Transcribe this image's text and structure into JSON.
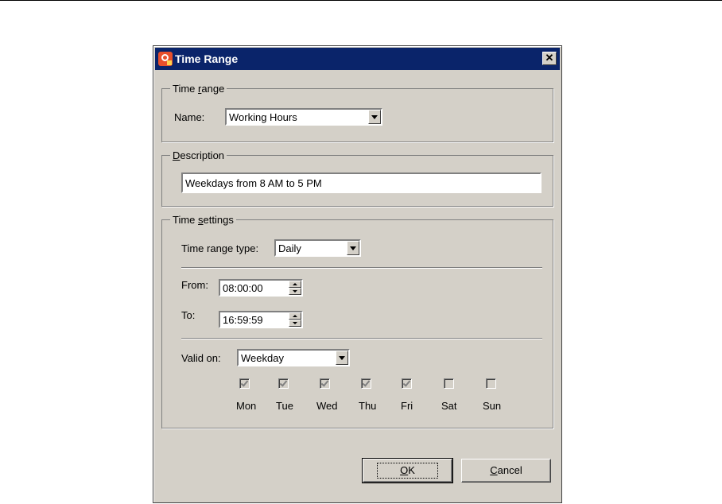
{
  "window": {
    "title": "Time Range",
    "close_glyph": "✕"
  },
  "time_range_group": {
    "legend_pre": "Time ",
    "legend_accel": "r",
    "legend_post": "ange",
    "name_label": "Name:",
    "name_value": "Working Hours"
  },
  "description_group": {
    "legend_accel": "D",
    "legend_post": "escription",
    "value": "Weekdays from 8 AM to 5 PM"
  },
  "time_settings_group": {
    "legend_pre": "Time ",
    "legend_accel": "s",
    "legend_post": "ettings",
    "type_label": "Time range type:",
    "type_value": "Daily",
    "from_label": "From:",
    "from_value": "08:00:00",
    "to_label": "To:",
    "to_value": "16:59:59",
    "valid_on_label": "Valid on:",
    "valid_on_value": "Weekday",
    "days": [
      {
        "label": "Mon",
        "checked": true
      },
      {
        "label": "Tue",
        "checked": true
      },
      {
        "label": "Wed",
        "checked": true
      },
      {
        "label": "Thu",
        "checked": true
      },
      {
        "label": "Fri",
        "checked": true
      },
      {
        "label": "Sat",
        "checked": false
      },
      {
        "label": "Sun",
        "checked": false
      }
    ]
  },
  "buttons": {
    "ok_accel": "O",
    "ok_post": "K",
    "cancel_accel": "C",
    "cancel_post": "ancel"
  }
}
